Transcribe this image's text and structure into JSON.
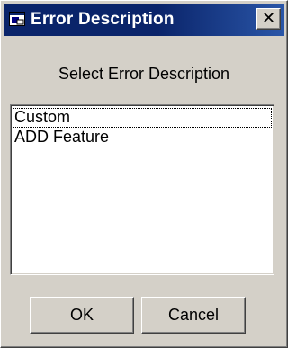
{
  "window": {
    "title": "Error Description",
    "close_glyph": "✕"
  },
  "dialog": {
    "prompt": "Select Error Description"
  },
  "list": {
    "items": [
      "Custom",
      "ADD Feature"
    ],
    "focused_index": 0
  },
  "buttons": {
    "ok_label": "OK",
    "cancel_label": "Cancel"
  },
  "icons": {
    "app_icon": "window-app-icon",
    "close_icon": "close-icon"
  },
  "colors": {
    "titlebar": "#0a246a",
    "face": "#d4d0c8"
  }
}
